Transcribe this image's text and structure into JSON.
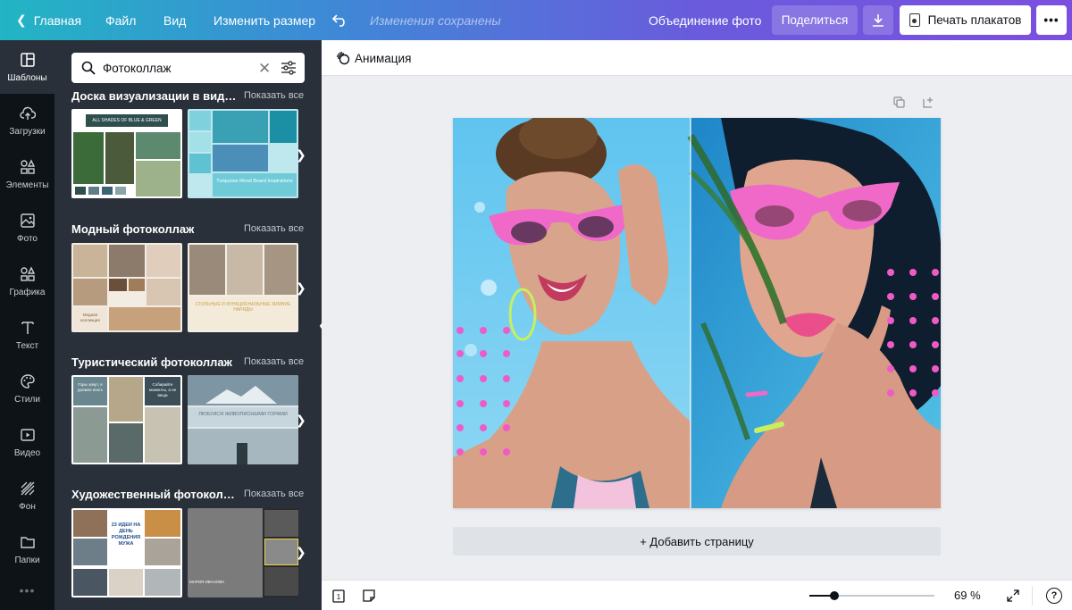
{
  "topbar": {
    "home": "Главная",
    "file": "Файл",
    "view": "Вид",
    "resize": "Изменить размер",
    "saved_status": "Изменения сохранены",
    "title": "Объединение фото",
    "share": "Поделиться",
    "print": "Печать плакатов",
    "more": "•••",
    "undo_icon": "undo-icon",
    "download_icon": "download-icon"
  },
  "rail": [
    {
      "label": "Шаблоны",
      "icon": "templates-icon"
    },
    {
      "label": "Загрузки",
      "icon": "upload-icon"
    },
    {
      "label": "Элементы",
      "icon": "elements-icon"
    },
    {
      "label": "Фото",
      "icon": "photo-icon"
    },
    {
      "label": "Графика",
      "icon": "graphics-icon"
    },
    {
      "label": "Текст",
      "icon": "text-icon"
    },
    {
      "label": "Стили",
      "icon": "palette-icon"
    },
    {
      "label": "Видео",
      "icon": "video-icon"
    },
    {
      "label": "Фон",
      "icon": "background-icon"
    },
    {
      "label": "Папки",
      "icon": "folder-icon"
    }
  ],
  "rail_more": "•••",
  "panel": {
    "search_value": "Фотоколлаж",
    "show_all": "Показать все",
    "sections": [
      {
        "title": "Доска визуализации в виде ...",
        "t1_text": "ALL SHADES OF BLUE & GREEN",
        "t2_text": "Turquoise Mood Board Inspirations"
      },
      {
        "title": "Модный фотоколлаж",
        "t1_text": "Модная коллекция",
        "t2_text": "СТИЛЬНЫЕ И ФУНКЦИОНАЛЬНЫЕ ЗИМНИЕ НАРЯДЫ"
      },
      {
        "title": "Туристический фотоколлаж",
        "t1_text": "Горы зовут, я должен ехать",
        "t1_text2": "Собирайте моменты, а не вещи",
        "t2_text": "ЛЮБУЙСЯ ЖИВОПИСНЫМИ ГОРАМИ"
      },
      {
        "title": "Художественный фотоколлаж",
        "t1_text": "23 ИДЕИ НА ДЕНЬ РОЖДЕНИЯ МУЖА",
        "t2_text": "МАРИЯ ИВАНОВА"
      }
    ]
  },
  "editor": {
    "animation": "Анимация",
    "add_page": "+ Добавить страницу"
  },
  "bottombar": {
    "page_number": "1",
    "zoom_percent": 69,
    "zoom_label": "69 %",
    "help": "?"
  },
  "colors": {
    "accent_pink": "#f05ac8",
    "panel_bg": "#293039",
    "rail_bg": "#0e1318"
  }
}
